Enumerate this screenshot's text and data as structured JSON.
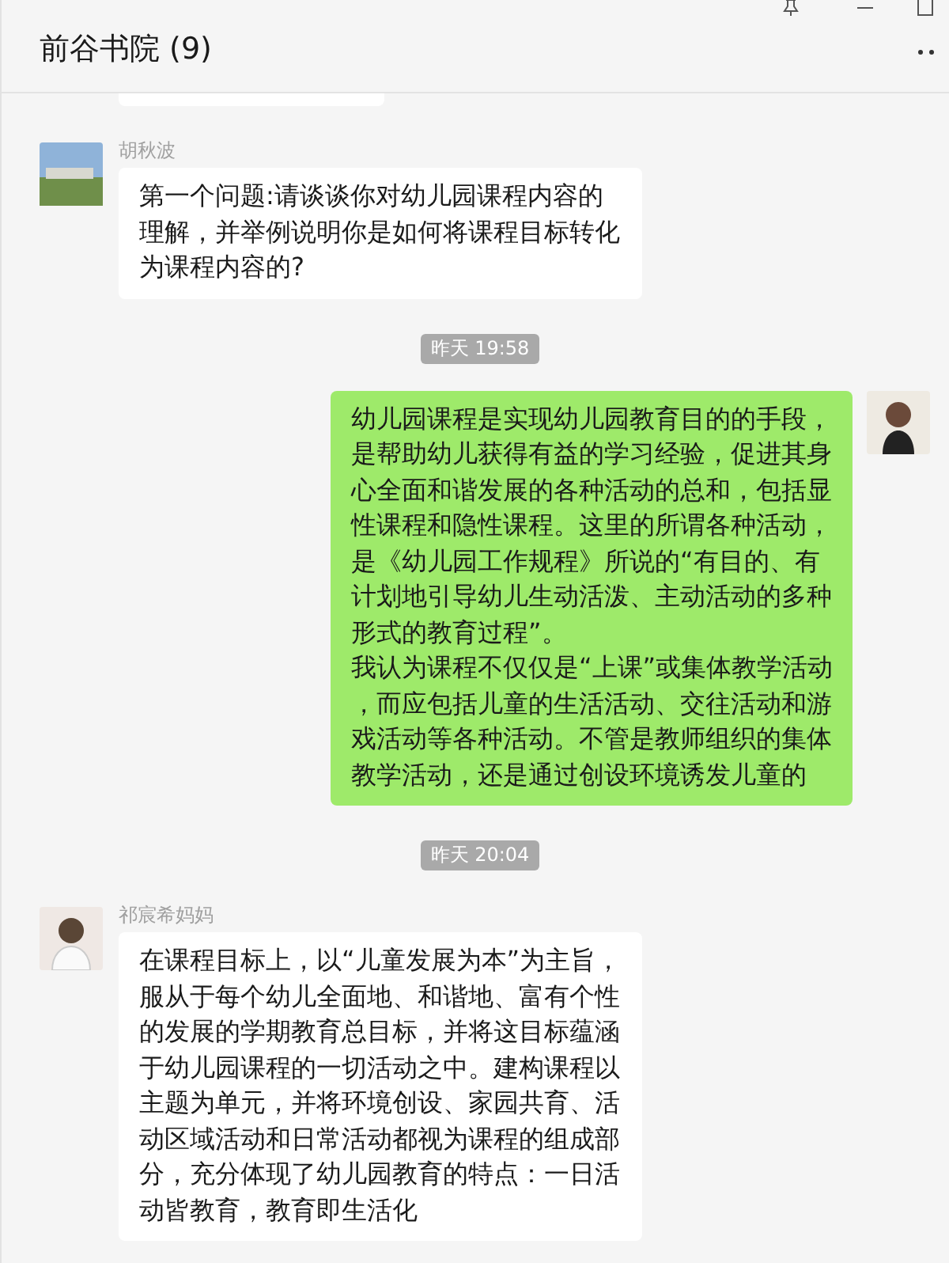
{
  "window": {
    "title": "前谷书院 (9)"
  },
  "messages": [
    {
      "kind": "partial"
    },
    {
      "kind": "received",
      "sender": "胡秋波",
      "paragraphs": [
        "第一个问题:请谈谈你对幼儿园课程内容的理解，并举例说明你是如何将课程目标转化为课程内容的?"
      ]
    },
    {
      "kind": "time",
      "text": "昨天 19:58"
    },
    {
      "kind": "sent",
      "paragraphs": [
        "幼儿园课程是实现幼儿园教育目的的手段，是帮助幼儿获得有益的学习经验，促进其身心全面和谐发展的各种活动的总和，包括显性课程和隐性课程。这里的所谓各种活动，是《幼儿园工作规程》所说的“有目的、有计划地引导幼儿生动活泼、主动活动的多种形式的教育过程”。",
        "我认为课程不仅仅是“上课”或集体教学活动，而应包括儿童的生活活动、交往活动和游戏活动等各种活动。不管是教师组织的集体教学活动，还是通过创设环境诱发儿童的"
      ]
    },
    {
      "kind": "time",
      "text": "昨天 20:04"
    },
    {
      "kind": "received",
      "sender": "祁宸希妈妈",
      "paragraphs": [
        "在课程目标上，以“儿童发展为本”为主旨，服从于每个幼儿全面地、和谐地、富有个性的发展的学期教育总目标，并将这目标蕴涵于幼儿园课程的一切活动之中。建构课程以主题为单元，并将环境创设、家园共育、活动区域活动和日常活动都视为课程的组成部分，充分体现了幼儿园教育的特点：一日活动皆教育，教育即生活化"
      ]
    }
  ]
}
